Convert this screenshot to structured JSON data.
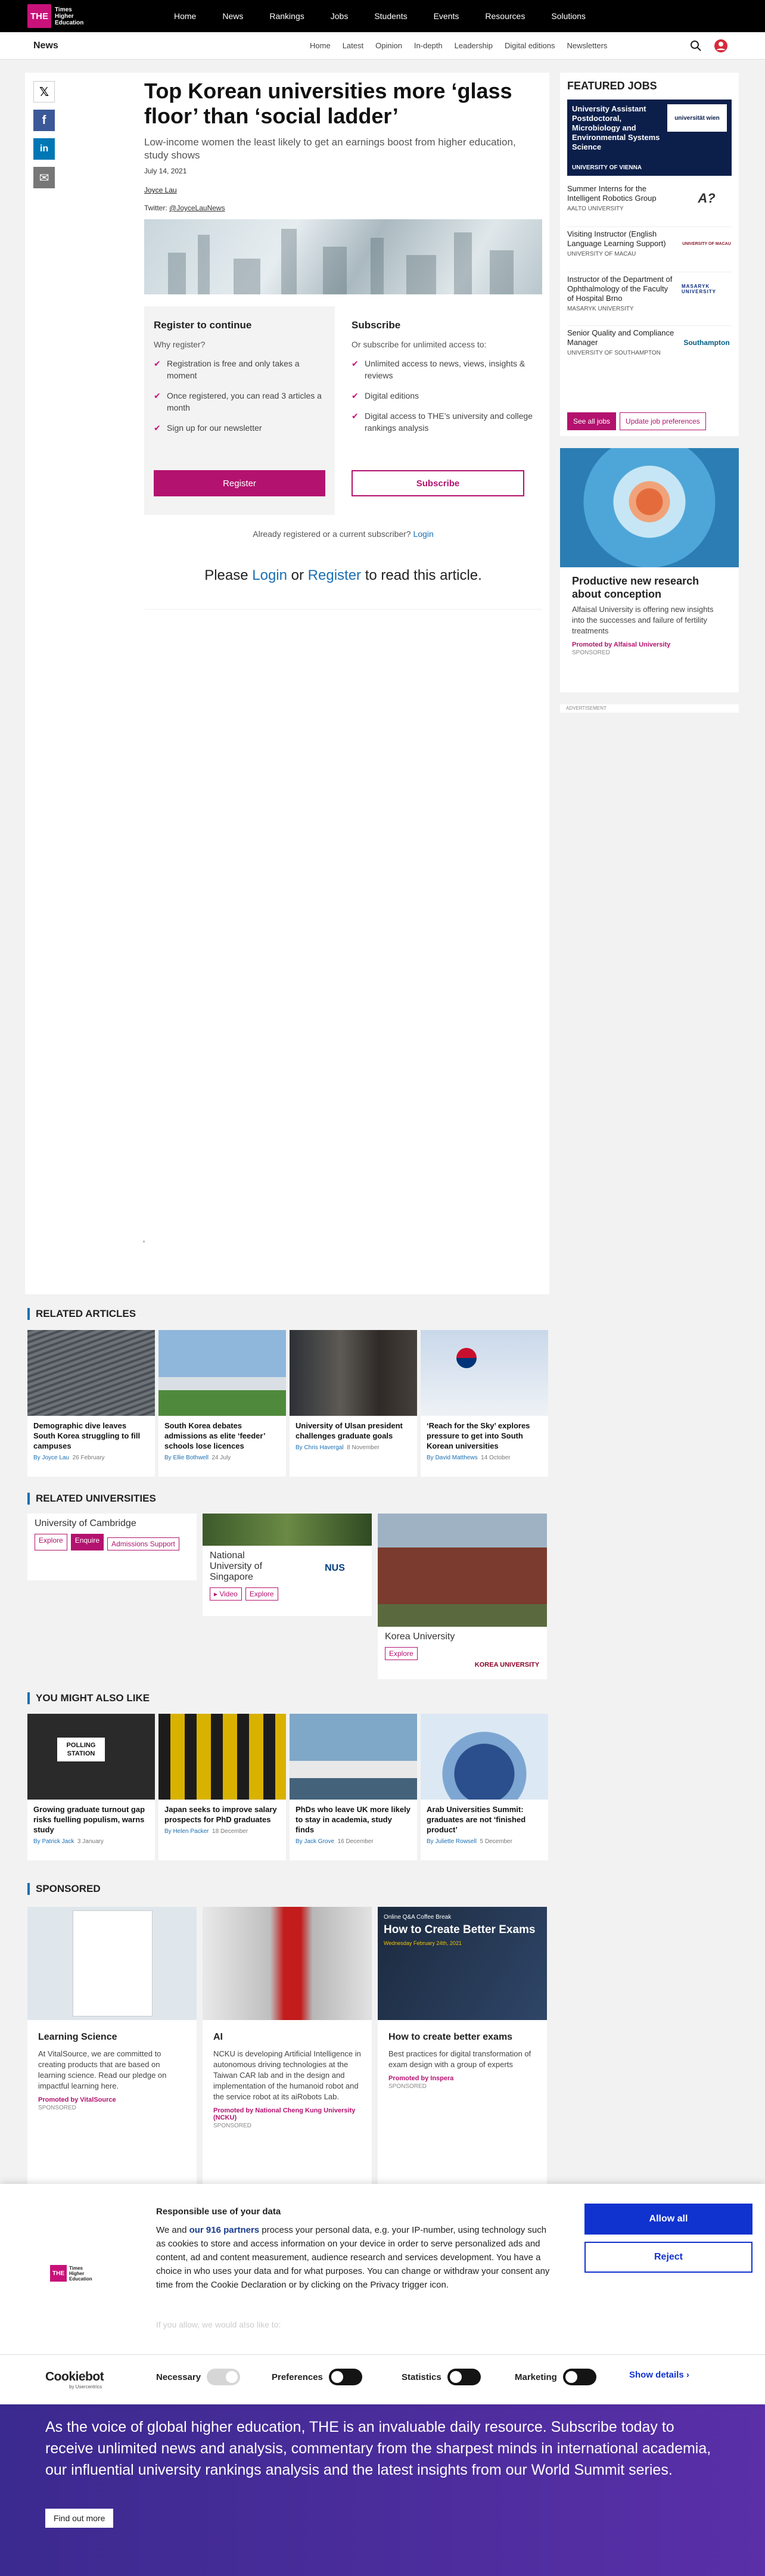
{
  "brand": {
    "logo_short": "THE",
    "logo_text": "Times Higher Education"
  },
  "topnav": [
    "Home",
    "News",
    "Rankings",
    "Jobs",
    "Students",
    "Events",
    "Resources",
    "Solutions"
  ],
  "subbar": {
    "section": "News",
    "items": [
      "Home",
      "Latest",
      "Opinion",
      "In-depth",
      "Leadership",
      "Digital editions",
      "Newsletters"
    ]
  },
  "share": {
    "x": "𝕏",
    "facebook": "f",
    "linkedin": "in",
    "email": "✉"
  },
  "article": {
    "title": "Top Korean universities more ‘glass floor’ than ‘social ladder’",
    "subtitle": "Low-income women the least likely to get an earnings boost from higher education, study shows",
    "date": "July 14, 2021",
    "author": "Joyce Lau",
    "twitter_prefix": "Twitter: ",
    "twitter_handle": "@JoyceLauNews"
  },
  "paywall": {
    "register_head": "Register to continue",
    "register_q": "Why register?",
    "register_items": [
      "Registration is free and only takes a moment",
      "Once registered, you can read 3 articles a month",
      "Sign up for our newsletter"
    ],
    "register_btn": "Register",
    "subscribe_head": "Subscribe",
    "subscribe_q": "Or subscribe for unlimited access to:",
    "subscribe_items": [
      "Unlimited access to news, views, insights & reviews",
      "Digital editions",
      "Digital access to THE’s university and college rankings analysis"
    ],
    "subscribe_btn": "Subscribe",
    "already_text": "Already registered or a current subscriber? ",
    "already_link": "Login",
    "please_1": "Please ",
    "please_login": "Login",
    "please_2": " or ",
    "please_register": "Register",
    "please_3": " to read this article."
  },
  "jobs": {
    "title": "FEATURED JOBS",
    "featured": {
      "title": "University Assistant Postdoctoral, Microbiology and Environmental Systems Science",
      "employer": "UNIVERSITY OF VIENNA",
      "logo": "universität wien"
    },
    "items": [
      {
        "title": "Summer Interns for the Intelligent Robotics Group",
        "employer": "AALTO UNIVERSITY",
        "logo": "A?"
      },
      {
        "title": "Visiting Instructor (English Language Learning Support)",
        "employer": "UNIVERSITY OF MACAU",
        "logo": "UNIVERSITY OF MACAU"
      },
      {
        "title": "Instructor of the Department of Ophthalmology of the Faculty of Hospital Brno",
        "employer": "MASARYK UNIVERSITY",
        "logo": "MASARYK UNIVERSITY"
      },
      {
        "title": "Senior Quality and Compliance Manager",
        "employer": "UNIVERSITY OF SOUTHAMPTON",
        "logo": "Southampton"
      }
    ],
    "see_all": "See all jobs",
    "prefs": "Update job preferences"
  },
  "promo": {
    "title": "Productive new research about conception",
    "text": "Alfaisal University is offering new insights into the successes and failure of fertility treatments",
    "by": "Promoted by Alfaisal University",
    "sponsored": "SPONSORED",
    "ad_label": "ADVERTISEMENT"
  },
  "related_articles": {
    "title": "RELATED ARTICLES",
    "items": [
      {
        "title": "Demographic dive leaves South Korea struggling to fill campuses",
        "author": "By Joyce Lau",
        "date": "26 February"
      },
      {
        "title": "South Korea debates admissions as elite ‘feeder’ schools lose licences",
        "author": "By Ellie Bothwell",
        "date": "24 July"
      },
      {
        "title": "University of Ulsan president challenges graduate goals",
        "author": "By Chris Havergal",
        "date": "8 November"
      },
      {
        "title": "‘Reach for the Sky’ explores pressure to get into South Korean universities",
        "author": "By David Matthews",
        "date": "14 October"
      }
    ]
  },
  "related_universities": {
    "title": "RELATED UNIVERSITIES",
    "items": [
      {
        "name": "University of Cambridge",
        "tags": [
          "Explore",
          "Enquire",
          "Admissions Support"
        ],
        "logo": ""
      },
      {
        "name": "National University of Singapore",
        "tags": [
          "▸ Video",
          "Explore"
        ],
        "logo": "NUS"
      },
      {
        "name": "Korea University",
        "tags": [
          "Explore"
        ],
        "logo": "KOREA UNIVERSITY"
      }
    ]
  },
  "you_might": {
    "title": "YOU MIGHT ALSO LIKE",
    "items": [
      {
        "title": "Growing graduate turnout gap risks fuelling populism, warns study",
        "author": "By Patrick Jack",
        "date": "3 January",
        "sign": "POLLING STATION"
      },
      {
        "title": "Japan seeks to improve salary prospects for PhD graduates",
        "author": "By Helen Packer",
        "date": "18 December",
        "sign": ""
      },
      {
        "title": "PhDs who leave UK more likely to stay in academia, study finds",
        "author": "By Jack Grove",
        "date": "16 December",
        "sign": ""
      },
      {
        "title": "Arab Universities Summit: graduates are not ‘finished product’",
        "author": "By Juliette Rowsell",
        "date": "5 December",
        "sign": ""
      }
    ]
  },
  "sponsored": {
    "title": "SPONSORED",
    "items": [
      {
        "title": "Learning Science",
        "text": "At VitalSource, we are committed to creating products that are based on learning science. Read our pledge on impactful learning here.",
        "by": "Promoted by VitalSource",
        "label": "SPONSORED"
      },
      {
        "title": "AI",
        "text": "NCKU is developing Artificial Intelligence in autonomous driving technologies at the Taiwan CAR lab and in the design and implementation of the humanoid robot and the service robot at its aiRobots Lab.",
        "by": "Promoted by National Cheng Kung University (NCKU)",
        "label": "SPONSORED"
      },
      {
        "title": "How to create better exams",
        "text": "Best practices for digital transformation of exam design with a group of experts",
        "by": "Promoted by Inspera",
        "label": "SPONSORED",
        "img_small": "Online Q&A Coffee Break",
        "img_big": "How to Create Better Exams",
        "img_date": "Wednesday February 24th, 2021"
      }
    ]
  },
  "banner": {
    "text": "As the voice of global higher education, THE is an invaluable daily resource. Subscribe today to receive unlimited news and analysis, commentary from the sharpest minds in international academia, our influential university rankings analysis and the latest insights from our World Summit series.",
    "button": "Find out more"
  },
  "cookie": {
    "title": "Responsible use of your data",
    "body_1": "We and ",
    "body_link": "our 916 partners",
    "body_2": " process your personal data, e.g. your IP-number, using technology such as cookies to store and access information on your device in order to serve personalized ads and content, ad and content measurement, audience research and services development. You have a choice in who uses your data and for what purposes. You can change or withdraw your consent any time from the Cookie Declaration or by clicking on the Privacy trigger icon.",
    "fade": "If you allow, we would also like to:",
    "allow": "Allow all",
    "reject": "Reject",
    "brand": "Cookiebot",
    "brand_sub": "by Usercentrics",
    "toggles": [
      "Necessary",
      "Preferences",
      "Statistics",
      "Marketing"
    ],
    "show_details": "Show details"
  }
}
